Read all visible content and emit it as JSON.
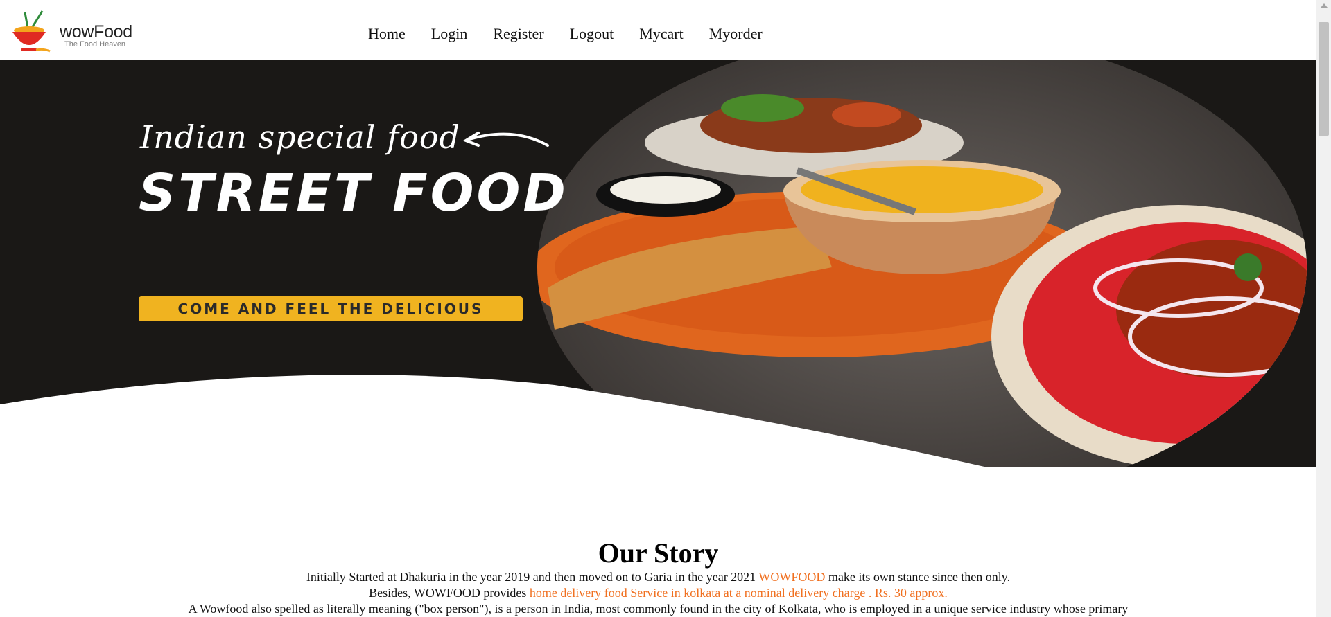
{
  "brand": {
    "name": "wowFood",
    "tagline": "The Food Heaven",
    "logo_icon": "food-bowl-with-chopsticks-icon"
  },
  "nav": {
    "items": [
      "Home",
      "Login",
      "Register",
      "Logout",
      "Mycart",
      "Myorder"
    ]
  },
  "hero": {
    "script_title": "Indian special food",
    "main_title": "STREET FOOD",
    "cta_label": "COME AND FEEL THE DELICIOUS",
    "arrow_icon": "hand-drawn-arrow-left-icon",
    "colors": {
      "background": "#1a1816",
      "cta": "#f0b320"
    }
  },
  "story": {
    "heading": "Our Story",
    "line1": {
      "before": "Initially Started at Dhakuria in the year 2019 and then moved on to Garia in the year 2021 ",
      "highlight": "WOWFOOD",
      "after": " make its own stance since then only."
    },
    "line2": {
      "before": "Besides, WOWFOOD provides ",
      "highlight": "home delivery food Service in kolkata at a nominal delivery charge . Rs. 30 approx."
    },
    "line3": "A Wowfood also spelled as literally meaning (\"box person\"), is a person in India, most commonly found in the city of Kolkata, who is employed in a unique service industry whose primary"
  },
  "colors": {
    "accent": "#f07020"
  }
}
